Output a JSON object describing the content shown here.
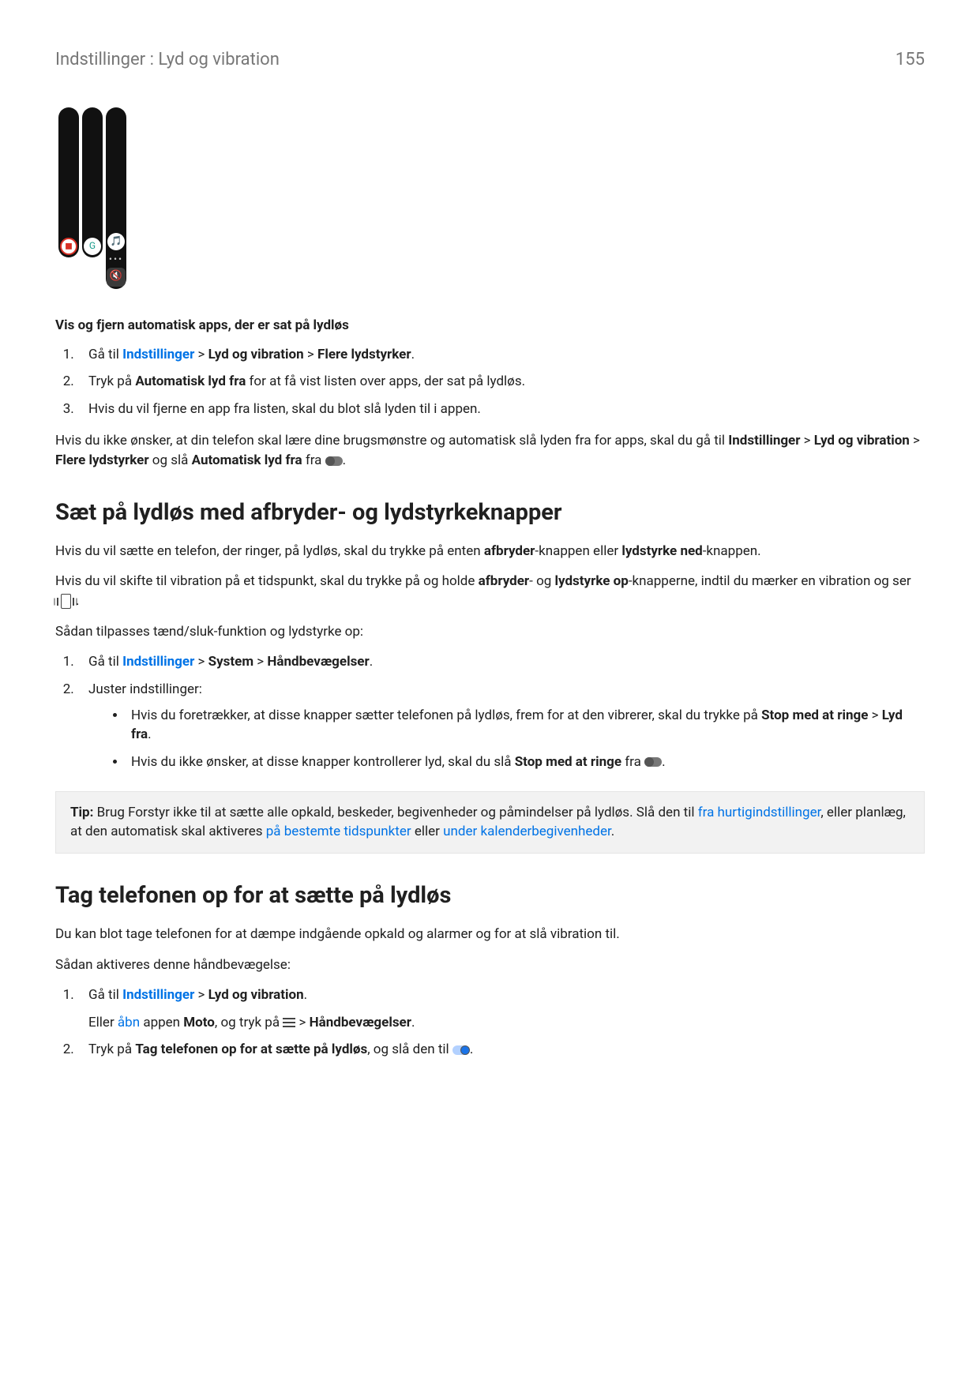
{
  "header": {
    "breadcrumb": "Indstillinger : Lyd og vibration",
    "page": "155"
  },
  "fig": {
    "knob1": "◼",
    "knob2": "G",
    "knob3": "🎵",
    "dots": "•••",
    "mute": "🔇"
  },
  "s1": {
    "title": "Vis og fjern automatisk apps, der er sat på lydløs",
    "li1a": "Gå til ",
    "li1b": "Indstillinger",
    "li1c": " > ",
    "li1d": "Lyd og vibration",
    "li1e": " > ",
    "li1f": "Flere lydstyrker",
    "li1g": ".",
    "li2a": "Tryk på ",
    "li2b": "Automatisk lyd fra",
    "li2c": " for at få vist listen over apps, der sat på lydløs.",
    "li3": "Hvis du vil fjerne en app fra listen, skal du blot slå lyden til i appen.",
    "p1a": "Hvis du ikke ønsker, at din telefon skal lære dine brugsmønstre og automatisk slå lyden fra for apps, skal du gå til ",
    "p1b": "Indstillinger",
    "p1c": " > ",
    "p1d": "Lyd og vibration",
    "p1e": " > ",
    "p1f": "Flere lydstyrker",
    "p1g": " og slå ",
    "p1h": "Automatisk lyd fra",
    "p1i": " fra ",
    "p1j": "."
  },
  "s2": {
    "title": "Sæt på lydløs med afbryder- og lydstyrkeknapper",
    "p1a": "Hvis du vil sætte en telefon, der ringer, på lydløs, skal du trykke på enten ",
    "p1b": "afbryder",
    "p1c": "-knappen eller ",
    "p1d": "lydstyrke ned",
    "p1e": "-knappen.",
    "p2a": "Hvis du vil skifte til vibration på et tidspunkt, skal du trykke på og holde ",
    "p2b": "afbryder",
    "p2c": "- og ",
    "p2d": "lydstyrke op",
    "p2e": "-knapperne, indtil du mærker en vibration og ser ",
    "p2f": ".",
    "p3": "Sådan tilpasses tænd/sluk-funktion og lydstyrke op:",
    "li1a": "Gå til ",
    "li1b": "Indstillinger",
    "li1c": " > ",
    "li1d": "System",
    "li1e": " > ",
    "li1f": "Håndbevægelser",
    "li1g": ".",
    "li2": "Juster indstillinger:",
    "b1a": "Hvis du foretrækker, at disse knapper sætter telefonen på lydløs, frem for at den vibrerer, skal du trykke på ",
    "b1b": "Stop med at ringe",
    "b1c": " > ",
    "b1d": "Lyd fra",
    "b1e": ".",
    "b2a": "Hvis du ikke ønsker, at disse knapper kontrollerer lyd, skal du slå ",
    "b2b": "Stop med at ringe",
    "b2c": " fra ",
    "b2d": "."
  },
  "tip": {
    "label": "Tip:",
    "t1": " Brug Forstyr ikke til at sætte alle opkald, beskeder, begivenheder og påmindelser på lydløs. Slå den til ",
    "l1": "fra hurtigindstillinger",
    "t2": ", eller planlæg, at den automatisk skal aktiveres ",
    "l2": "på bestemte tidspunkter",
    "t3": " eller ",
    "l3": "under kalenderbegivenheder",
    "t4": "."
  },
  "s3": {
    "title": "Tag telefonen op for at sætte på lydløs",
    "p1": "Du kan blot tage telefonen for at dæmpe indgående opkald og alarmer og for at slå vibration til.",
    "p2": "Sådan aktiveres denne håndbevægelse:",
    "li1a": "Gå til ",
    "li1b": "Indstillinger",
    "li1c": " > ",
    "li1d": "Lyd og vibration",
    "li1e": ".",
    "li1alt_a": "Eller ",
    "li1alt_b": "åbn",
    "li1alt_c": " appen ",
    "li1alt_d": "Moto",
    "li1alt_e": ", og tryk på ",
    "li1alt_f": " > ",
    "li1alt_g": "Håndbevægelser",
    "li1alt_h": ".",
    "li2a": "Tryk på ",
    "li2b": "Tag telefonen op for at sætte på lydløs",
    "li2c": ", og slå den til ",
    "li2d": "."
  }
}
